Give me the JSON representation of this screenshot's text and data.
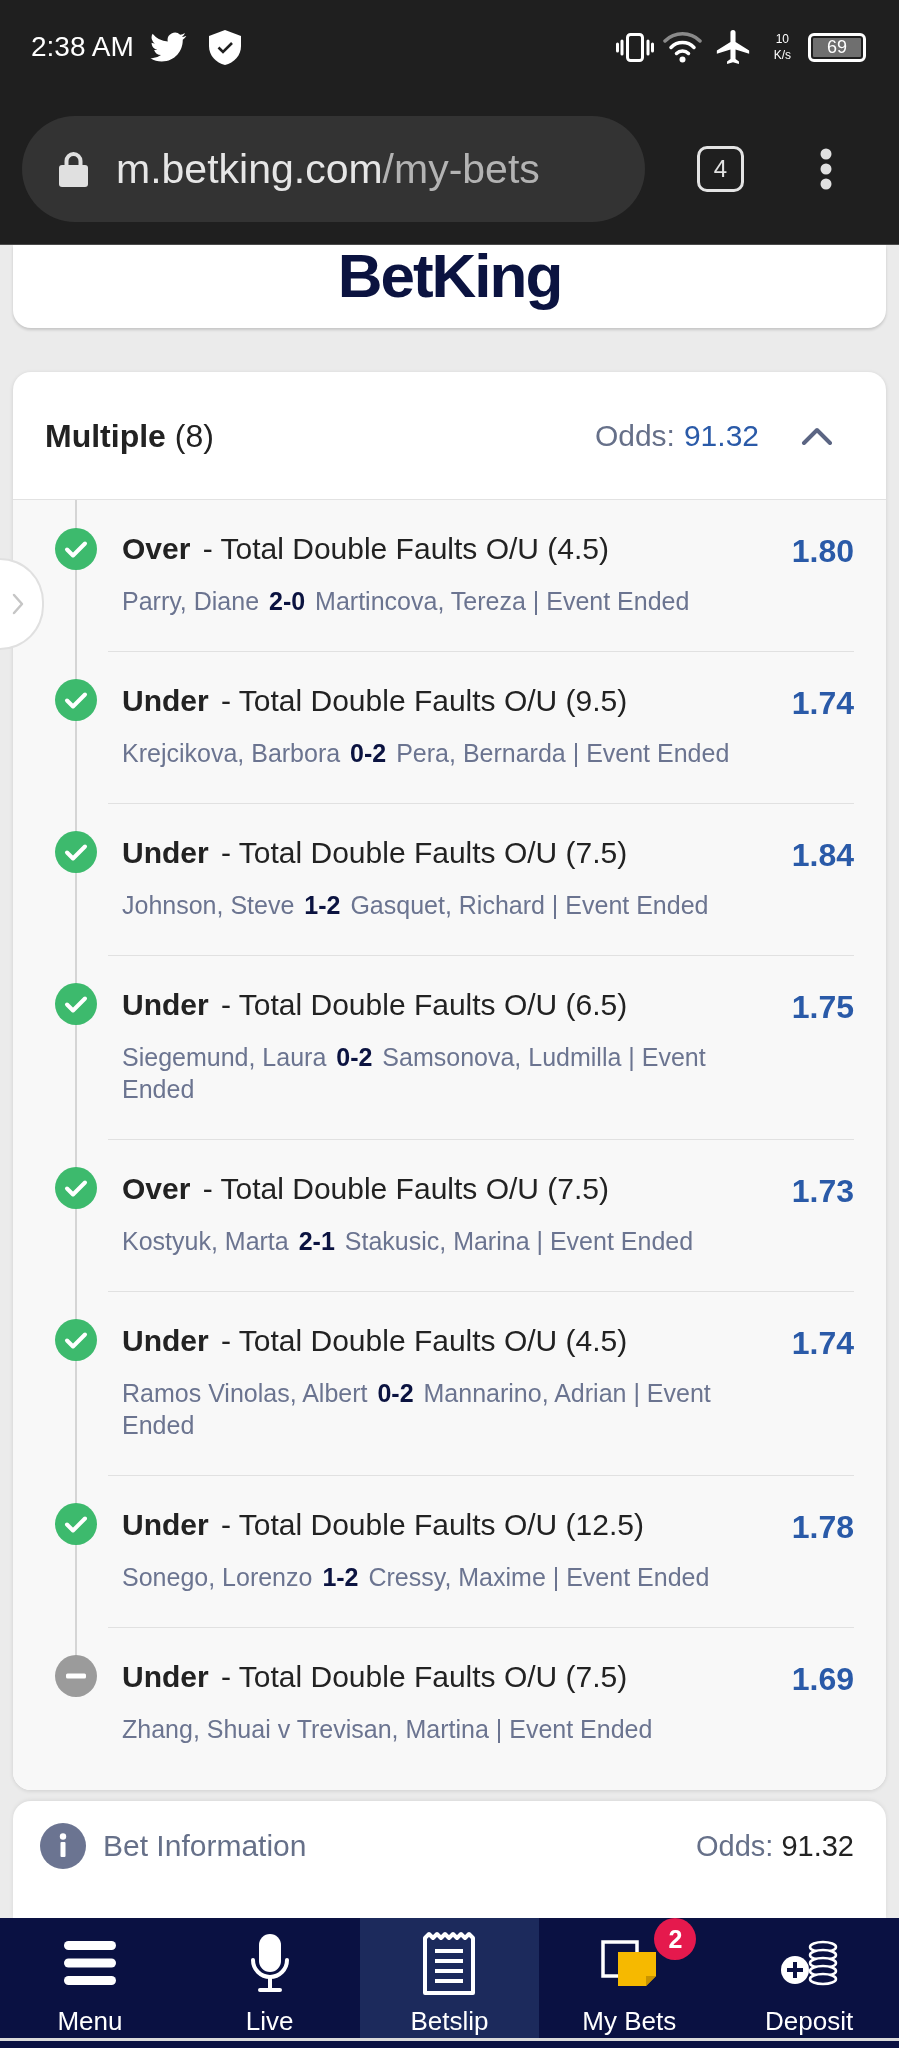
{
  "status_bar": {
    "time": "2:38 AM",
    "network_speed": {
      "value": "10",
      "unit": "K/s"
    },
    "battery": "69"
  },
  "browser": {
    "url": "m.betking.com/my-bets",
    "tab_count": "4"
  },
  "header": {
    "logo": "BetKing"
  },
  "bet": {
    "title": "**Multiple** (8)",
    "odds_label": "Odds:",
    "odds": "91.32",
    "expanded": true,
    "selections": [
      {
        "won": true,
        "title": "**Over** - Total Double Faults O/U (4.5)",
        "match": "Parry, Diane **2-0** Martincova, Tereza | Event Ended",
        "odds": "1.80"
      },
      {
        "won": true,
        "title": "**Under** - Total Double Faults O/U (9.5)",
        "match": "Krejcikova, Barbora **0-2** Pera, Bernarda | Event Ended",
        "odds": "1.74"
      },
      {
        "won": true,
        "title": "**Under** - Total Double Faults O/U (7.5)",
        "match": "Johnson, Steve **1-2** Gasquet, Richard | Event Ended",
        "odds": "1.84"
      },
      {
        "won": true,
        "title": "**Under** - Total Double Faults O/U (6.5)",
        "match": "Siegemund, Laura **0-2** Samsonova, Ludmilla | Event Ended",
        "odds": "1.75"
      },
      {
        "won": true,
        "title": "**Over** - Total Double Faults O/U (7.5)",
        "match": "Kostyuk, Marta **2-1** Stakusic, Marina | Event Ended",
        "odds": "1.73"
      },
      {
        "won": true,
        "title": "**Under** - Total Double Faults O/U (4.5)",
        "match": "Ramos Vinolas, Albert **0-2** Mannarino, Adrian | Event Ended",
        "odds": "1.74"
      },
      {
        "won": true,
        "title": "**Under** - Total Double Faults O/U (12.5)",
        "match": "Sonego, Lorenzo **1-2** Cressy, Maxime | Event Ended",
        "odds": "1.78"
      },
      {
        "won": false,
        "title": "**Under** - Total Double Faults O/U (7.5)",
        "match": "Zhang, Shuai v Trevisan, Martina | Event Ended",
        "odds": "1.69"
      }
    ]
  },
  "bet_information": {
    "label": "Bet Information",
    "odds_label": "Odds:",
    "odds": "91.32"
  },
  "nav": {
    "items": [
      {
        "label": "Menu",
        "selected": false
      },
      {
        "label": "Live",
        "selected": false
      },
      {
        "label": "Betslip",
        "selected": true
      },
      {
        "label": "My Bets",
        "selected": false,
        "badge": "2"
      },
      {
        "label": "Deposit",
        "selected": false
      }
    ]
  }
}
